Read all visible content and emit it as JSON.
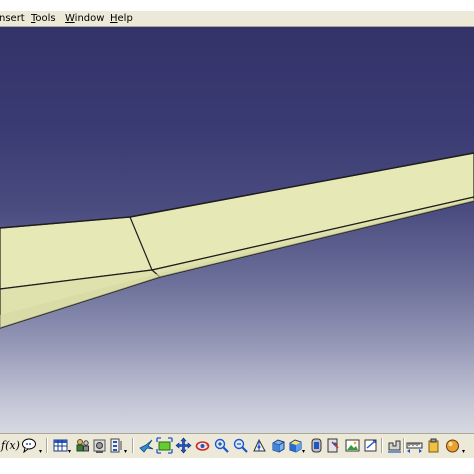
{
  "menubar": {
    "items": [
      {
        "label": "nsert"
      },
      {
        "label": "Tools",
        "underline": "T",
        "rest": "ools"
      },
      {
        "label": "Window",
        "underline": "W",
        "rest": "indow"
      },
      {
        "label": "Help",
        "underline": "H",
        "rest": "elp"
      }
    ]
  },
  "viewport": {
    "background_top": "#33336a",
    "background_bottom": "#d6d8e2",
    "surface_color": "#e6e9b6",
    "edge_color": "#1e1e1e"
  },
  "toolbar": {
    "formula_label": "f(x)",
    "icons": [
      "formula-icon",
      "chat-icon",
      "table-icon",
      "catalog-icon",
      "options-icon",
      "fly-icon",
      "fit-all-icon",
      "pan-icon",
      "rotate-icon",
      "zoom-in-icon",
      "zoom-out-icon",
      "normal-view-icon",
      "iso-view-icon",
      "render-style-icon",
      "hide-show-icon",
      "swap-space-icon",
      "update-icon",
      "measure-icon",
      "apply-material-icon"
    ]
  }
}
